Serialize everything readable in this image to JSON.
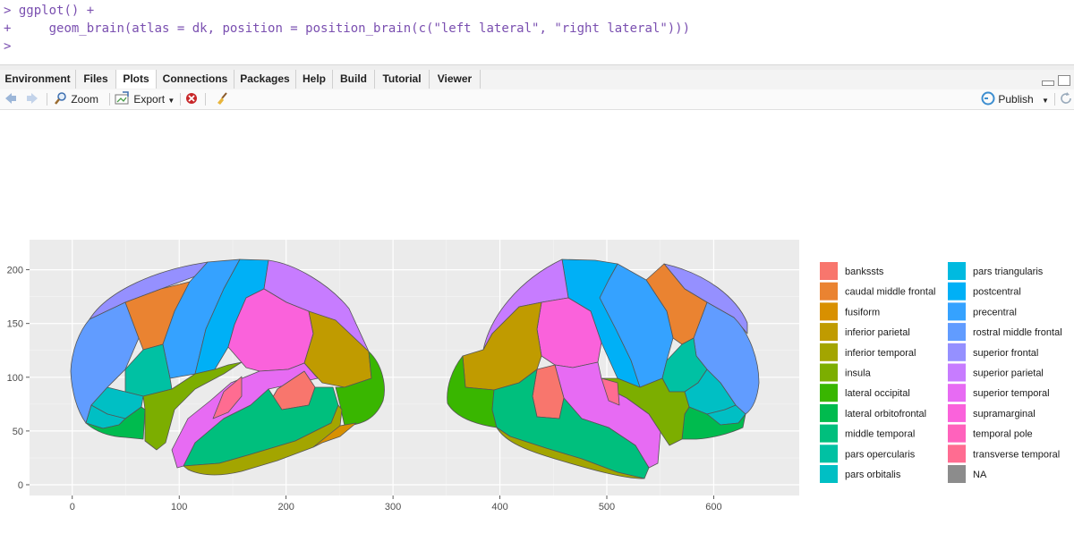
{
  "console": {
    "prompt": ">",
    "continuation": "+",
    "line1": "ggplot() +",
    "line2": "    geom_brain(atlas = dk, position = position_brain(c(\"left lateral\", \"right lateral\")))"
  },
  "tabs": [
    {
      "label": "Environment"
    },
    {
      "label": "Files"
    },
    {
      "label": "Plots"
    },
    {
      "label": "Connections"
    },
    {
      "label": "Packages"
    },
    {
      "label": "Help"
    },
    {
      "label": "Build"
    },
    {
      "label": "Tutorial"
    },
    {
      "label": "Viewer"
    }
  ],
  "active_tab": "Plots",
  "toolbar": {
    "back_icon": "arrow-left-icon",
    "forward_icon": "arrow-right-icon",
    "zoom_label": "Zoom",
    "export_label": "Export",
    "publish_label": "Publish"
  },
  "chart_data": {
    "type": "other",
    "x_ticks": [
      "0",
      "100",
      "200",
      "300",
      "400",
      "500",
      "600"
    ],
    "y_ticks": [
      "0",
      "50",
      "100",
      "150",
      "200"
    ],
    "xlim": [
      -40,
      680
    ],
    "ylim": [
      -10,
      228
    ],
    "grid": true,
    "legend_placement": "right",
    "legend": [
      {
        "label": "bankssts",
        "color": "#F8766D"
      },
      {
        "label": "caudal middle frontal",
        "color": "#EA8331"
      },
      {
        "label": "fusiform",
        "color": "#D89000"
      },
      {
        "label": "inferior parietal",
        "color": "#C09B00"
      },
      {
        "label": "inferior temporal",
        "color": "#A3A500"
      },
      {
        "label": "insula",
        "color": "#7CAE00"
      },
      {
        "label": "lateral occipital",
        "color": "#39B600"
      },
      {
        "label": "lateral orbitofrontal",
        "color": "#00BB4E"
      },
      {
        "label": "middle temporal",
        "color": "#00BF7D"
      },
      {
        "label": "pars opercularis",
        "color": "#00C1A3"
      },
      {
        "label": "pars orbitalis",
        "color": "#00BFC4"
      },
      {
        "label": "pars triangularis",
        "color": "#00BAE0"
      },
      {
        "label": "postcentral",
        "color": "#00B0F6"
      },
      {
        "label": "precentral",
        "color": "#35A2FF"
      },
      {
        "label": "rostral middle frontal",
        "color": "#619CFF"
      },
      {
        "label": "superior frontal",
        "color": "#9590FF"
      },
      {
        "label": "superior parietal",
        "color": "#C77CFF"
      },
      {
        "label": "superior temporal",
        "color": "#E76BF3"
      },
      {
        "label": "supramarginal",
        "color": "#FA62DB"
      },
      {
        "label": "temporal pole",
        "color": "#FF62BC"
      },
      {
        "label": "transverse temporal",
        "color": "#FF6C91"
      },
      {
        "label": "NA",
        "color": "#8C8C8C"
      }
    ]
  }
}
